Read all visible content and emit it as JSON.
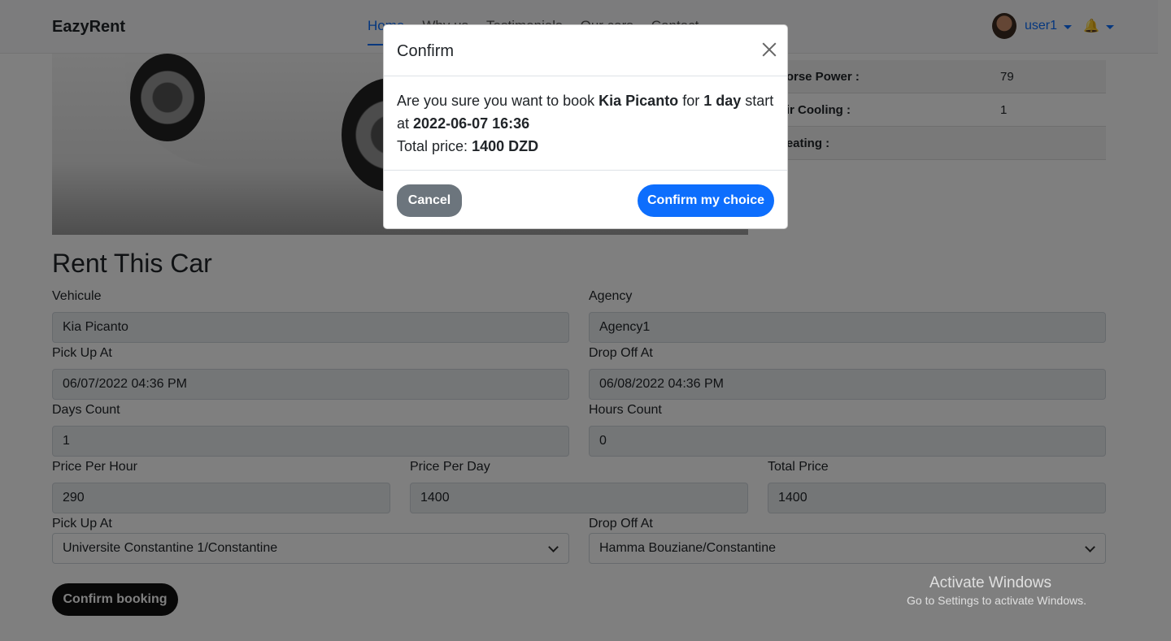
{
  "navbar": {
    "brand": "EazyRent",
    "links": [
      "Home",
      "Why us",
      "Testimonials",
      "Our cars",
      "Contact"
    ],
    "user": "user1"
  },
  "specs": [
    {
      "key": "Horse Power :",
      "value": "79"
    },
    {
      "key": "Air Cooling :",
      "value": "1"
    },
    {
      "key": "Heating :",
      "value": ""
    }
  ],
  "form": {
    "title": "Rent This Car",
    "vehicule_label": "Vehicule",
    "vehicule_value": "Kia Picanto",
    "agency_label": "Agency",
    "agency_value": "Agency1",
    "pickup_at_label": "Pick Up At",
    "pickup_at_value": "06/07/2022 04:36 PM",
    "dropoff_at_label": "Drop Off At",
    "dropoff_at_value": "06/08/2022 04:36 PM",
    "days_label": "Days Count",
    "days_value": "1",
    "hours_label": "Hours Count",
    "hours_value": "0",
    "price_hour_label": "Price Per Hour",
    "price_hour_value": "290",
    "price_day_label": "Price Per Day",
    "price_day_value": "1400",
    "total_label": "Total Price",
    "total_value": "1400",
    "pickup_loc_label": "Pick Up At",
    "pickup_loc_value": "Universite Constantine 1/Constantine",
    "dropoff_loc_label": "Drop Off At",
    "dropoff_loc_value": "Hamma Bouziane/Constantine",
    "submit": "Confirm booking"
  },
  "watermark": {
    "line1": "Activate Windows",
    "line2": "Go to Settings to activate Windows."
  },
  "modal": {
    "title": "Confirm",
    "text1": "Are you sure you want to book",
    "car": "Kia Picanto",
    "text2": "for",
    "duration": "1 day",
    "text3": "start at",
    "start": "2022-06-07 16:36",
    "price_label": "Total price:",
    "price": "1400 DZD",
    "cancel": "Cancel",
    "confirm": "Confirm my choice"
  }
}
